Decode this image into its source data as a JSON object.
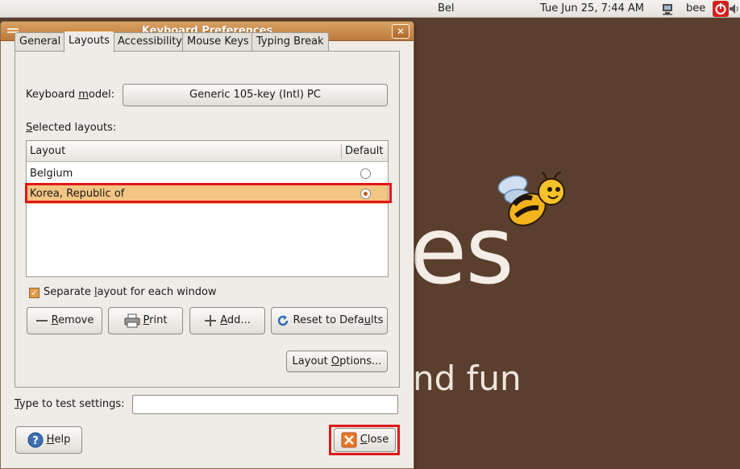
{
  "top_panel": {
    "keyboard_indicator": "Bel",
    "clock": "Tue Jun 25,  7:44 AM",
    "user": "bee",
    "icons": [
      "network-icon",
      "power-icon",
      "volume-icon"
    ]
  },
  "wallpaper": {
    "large_text": "es",
    "small_text": "nd fun",
    "logo": "bee-mascot"
  },
  "dialog": {
    "title": "Keyboard Preferences",
    "tabs": [
      {
        "label": "General",
        "active": false
      },
      {
        "label": "Layouts",
        "active": true
      },
      {
        "label": "Accessibility",
        "active": false
      },
      {
        "label": "Mouse Keys",
        "active": false
      },
      {
        "label": "Typing Break",
        "active": false
      }
    ],
    "keyboard_model": {
      "label_pre": "Keyboard ",
      "label_mnemonic": "m",
      "label_post": "odel:",
      "value": "Generic 105-key (Intl) PC"
    },
    "selected_layouts": {
      "label_mnemonic": "S",
      "label_post": "elected layouts:",
      "columns": [
        "Layout",
        "Default"
      ],
      "rows": [
        {
          "layout": "Belgium",
          "default": false,
          "selected": false
        },
        {
          "layout": "Korea, Republic of",
          "default": true,
          "selected": true
        }
      ]
    },
    "separate_layout": {
      "label_pre": "Separate ",
      "label_mnemonic": "l",
      "label_post": "ayout for each window",
      "checked": true
    },
    "buttons": {
      "remove": {
        "mnemonic": "R",
        "rest": "emove"
      },
      "print": {
        "mnemonic": "P",
        "rest": "rint"
      },
      "add": {
        "mnemonic": "A",
        "rest": "dd..."
      },
      "reset": {
        "pre": "Reset to Defa",
        "mnemonic": "u",
        "post": "lts"
      },
      "layout_options": {
        "pre": "Layout ",
        "mnemonic": "O",
        "post": "ptions..."
      },
      "help": {
        "mnemonic": "H",
        "rest": "elp"
      },
      "close": {
        "mnemonic": "C",
        "rest": "lose"
      }
    },
    "test": {
      "label_mnemonic": "T",
      "label_post": "ype to test settings:",
      "value": ""
    }
  },
  "colors": {
    "titlebar": "#c68744",
    "selection": "#f3c583",
    "highlight_box": "#e01818",
    "wallpaper": "#5b3f2e"
  }
}
